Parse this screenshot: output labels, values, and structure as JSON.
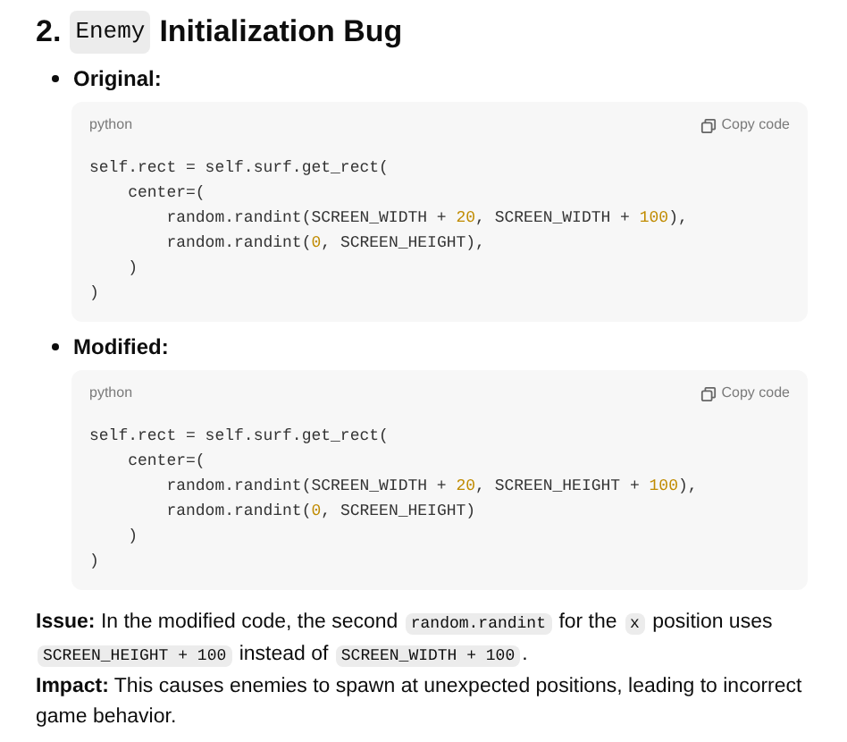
{
  "heading": {
    "number": "2.",
    "code": "Enemy",
    "title": "Initialization Bug"
  },
  "sections": [
    {
      "label": "Original:",
      "code_block": {
        "language": "python",
        "copy_label": "Copy code",
        "lines": [
          "self.rect = self.surf.get_rect(",
          "    center=(",
          "        random.randint(SCREEN_WIDTH + 20, SCREEN_WIDTH + 100),",
          "        random.randint(0, SCREEN_HEIGHT),",
          "    )",
          ")"
        ]
      }
    },
    {
      "label": "Modified:",
      "code_block": {
        "language": "python",
        "copy_label": "Copy code",
        "lines": [
          "self.rect = self.surf.get_rect(",
          "    center=(",
          "        random.randint(SCREEN_WIDTH + 20, SCREEN_HEIGHT + 100),",
          "        random.randint(0, SCREEN_HEIGHT)",
          "    )",
          ")"
        ]
      }
    }
  ],
  "notes": [
    {
      "label": "Issue:",
      "parts": [
        {
          "kind": "text",
          "text": " In the modified code, the second "
        },
        {
          "kind": "code",
          "text": "random.randint"
        },
        {
          "kind": "text",
          "text": " for the "
        },
        {
          "kind": "code",
          "text": "x"
        },
        {
          "kind": "text",
          "text": " position uses "
        },
        {
          "kind": "code",
          "text": "SCREEN_HEIGHT + 100"
        },
        {
          "kind": "text",
          "text": " instead of "
        },
        {
          "kind": "code",
          "text": "SCREEN_WIDTH + 100"
        },
        {
          "kind": "text",
          "text": "."
        }
      ]
    },
    {
      "label": "Impact:",
      "parts": [
        {
          "kind": "text",
          "text": " This causes enemies to spawn at unexpected positions, leading to incorrect game behavior."
        }
      ]
    }
  ]
}
